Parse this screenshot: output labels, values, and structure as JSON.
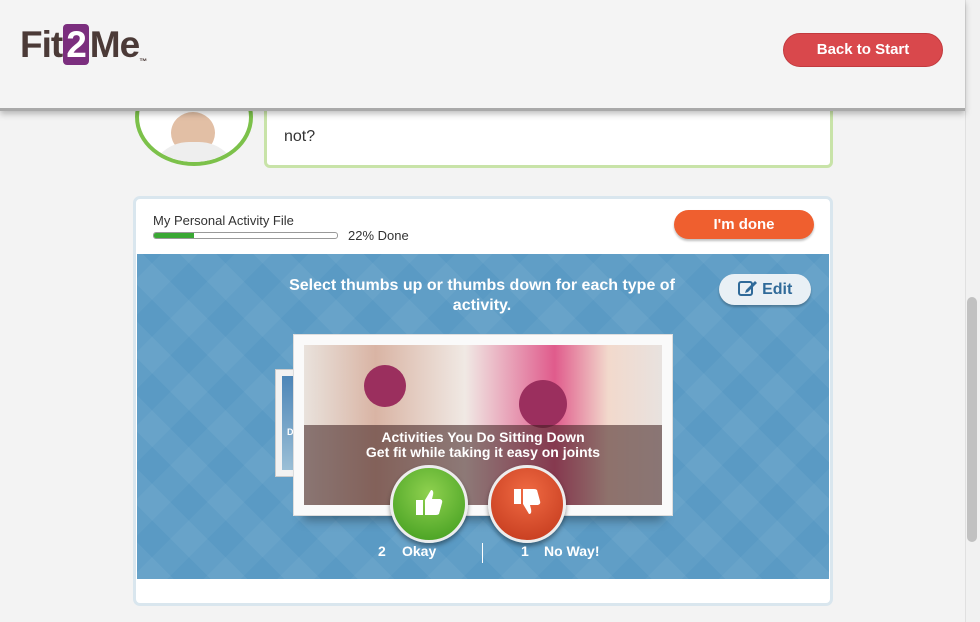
{
  "header": {
    "logo_left": "Fit",
    "logo_mid": "2",
    "logo_right": "Me",
    "logo_tm": "™",
    "back_label": "Back to Start"
  },
  "coach": {
    "message_visible": "not?"
  },
  "activity": {
    "file_title": "My Personal Activity File",
    "progress_percent": 22,
    "progress_text": "22% Done",
    "done_label": "I'm done",
    "instructions": "Select thumbs up or thumbs down for each type of activity.",
    "edit_label": "Edit",
    "card": {
      "title": "Activities You Do Sitting Down",
      "subtitle": "Get fit while taking it easy on joints"
    },
    "back_card_letter": "D",
    "okay": {
      "count": "2",
      "label": "Okay"
    },
    "noway": {
      "count": "1",
      "label": "No Way!"
    }
  },
  "colors": {
    "accent_green": "#7cc14a",
    "back_red": "#d9484c",
    "done_orange": "#ef5f2f",
    "stage_blue": "#5a9ac4"
  }
}
